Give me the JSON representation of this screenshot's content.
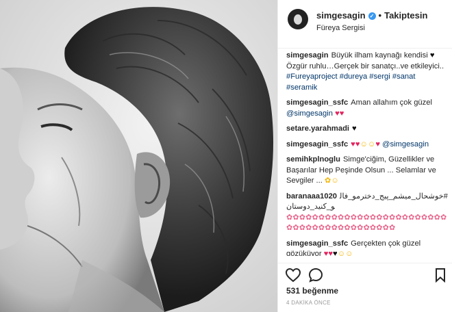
{
  "header": {
    "username": "simgesagin",
    "follow_status": "Takiptesin",
    "location": "Füreya Sergisi"
  },
  "comments": [
    {
      "user": "simgesagin",
      "parts": [
        {
          "t": "text",
          "v": "Büyük ilham kaynağı kendisi "
        },
        {
          "t": "heart-black",
          "v": "♥"
        },
        {
          "t": "text",
          "v": " Özgür ruhlu…Gerçek bir sanatçı..ve etkileyici.. "
        },
        {
          "t": "tag",
          "v": "#Fureyaproject"
        },
        {
          "t": "text",
          "v": " "
        },
        {
          "t": "tag",
          "v": "#dureya"
        },
        {
          "t": "text",
          "v": " "
        },
        {
          "t": "tag",
          "v": "#sergi"
        },
        {
          "t": "text",
          "v": " "
        },
        {
          "t": "tag",
          "v": "#sanat"
        },
        {
          "t": "text",
          "v": " "
        },
        {
          "t": "tag",
          "v": "#seramik"
        }
      ]
    },
    {
      "user": "simgesagin_ssfc",
      "parts": [
        {
          "t": "text",
          "v": "Aman allahım çok güzel "
        },
        {
          "t": "tag",
          "v": "@simgesagin"
        },
        {
          "t": "text",
          "v": " "
        },
        {
          "t": "heart",
          "v": "♥♥"
        }
      ]
    },
    {
      "user": "setare.yarahmadi",
      "parts": [
        {
          "t": "heart-black",
          "v": "♥"
        }
      ]
    },
    {
      "user": "simgesagin_ssfc",
      "parts": [
        {
          "t": "heart",
          "v": "♥♥"
        },
        {
          "t": "face",
          "v": "☺☺"
        },
        {
          "t": "heart",
          "v": "♥"
        },
        {
          "t": "text",
          "v": " "
        },
        {
          "t": "tag",
          "v": "@simgesagin"
        }
      ]
    },
    {
      "user": "semihkplnoglu",
      "parts": [
        {
          "t": "text",
          "v": "Simge'ciğim, Güzellikler ve Başarılar Hep Peşinde Olsun ... Selamlar ve Sevgiler ... "
        },
        {
          "t": "face",
          "v": "✿☺"
        }
      ]
    },
    {
      "user": "baranaaa1020",
      "parts": [
        {
          "t": "rtl",
          "v": "#خوشحال_میشم_پیج_دخترمو_فالو_کنید_دوستان"
        },
        {
          "t": "text",
          "v": " "
        },
        {
          "t": "flower",
          "v": "✿✿✿✿✿✿✿✿✿✿✿✿✿✿✿✿✿✿✿✿✿✿✿✿✿✿✿✿✿✿✿✿✿✿✿✿✿✿✿✿✿✿"
        }
      ]
    },
    {
      "user": "simgesagin_ssfc",
      "parts": [
        {
          "t": "text",
          "v": "Gerçekten çok güzel gözüküyor "
        },
        {
          "t": "heart",
          "v": "♥♥"
        },
        {
          "t": "heart-black",
          "v": "♥"
        },
        {
          "t": "face",
          "v": "☺☺"
        }
      ]
    }
  ],
  "actions": {
    "like_icon": "heart-outline-icon",
    "comment_icon": "comment-bubble-icon",
    "save_icon": "bookmark-icon"
  },
  "likes": "531 beğenme",
  "timestamp": "4 DAKİKA ÖNCE",
  "colors": {
    "link": "#003569",
    "heart": "#e0245e",
    "verified": "#3897f0",
    "muted": "#999999"
  }
}
